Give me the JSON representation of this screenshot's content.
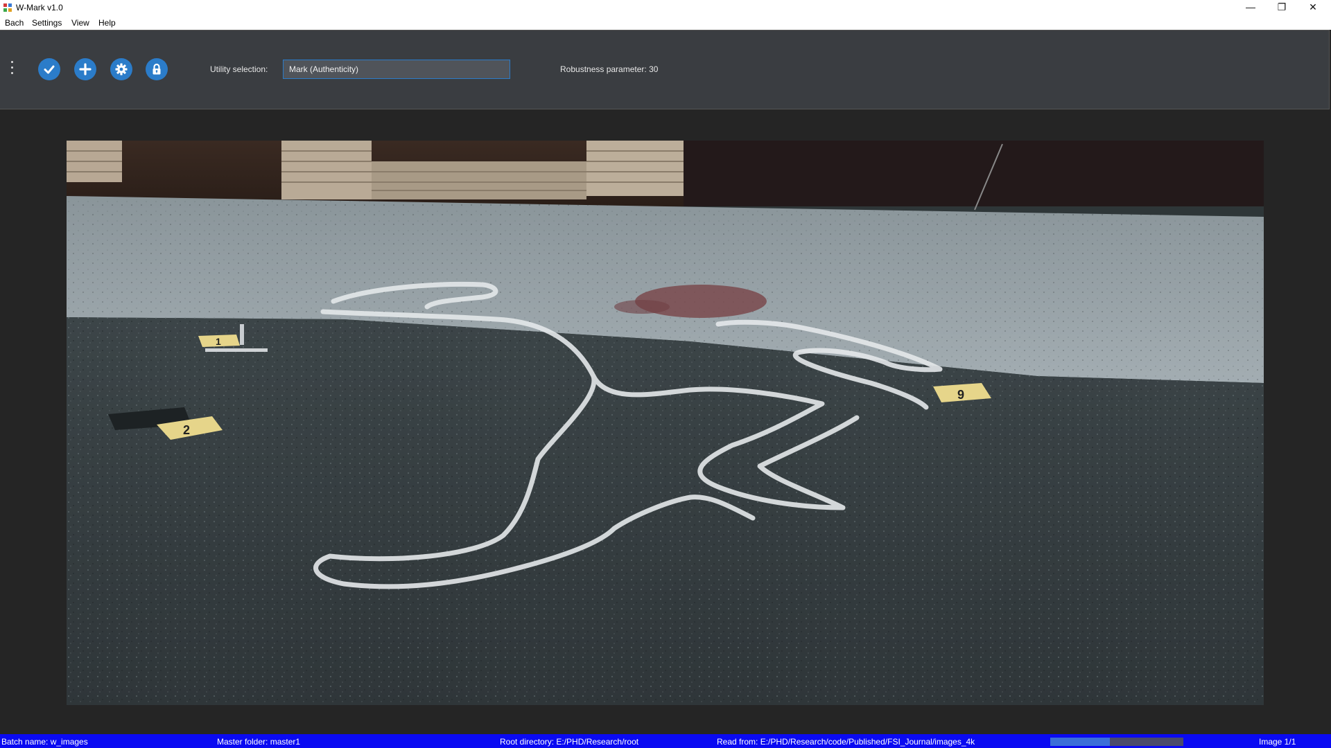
{
  "window": {
    "title": "W-Mark v1.0"
  },
  "menu": {
    "items": [
      "Bach",
      "Settings",
      "View",
      "Help"
    ]
  },
  "toolbar": {
    "icons": [
      "check-icon",
      "plus-icon",
      "gear-icon",
      "lock-icon"
    ],
    "utility_label": "Utility selection:",
    "utility_value": "Mark (Authenticity)",
    "robustness": "Robustness parameter: 30"
  },
  "viewer": {
    "markers": [
      "1",
      "2",
      "9"
    ]
  },
  "status": {
    "batch": "Batch name:  w_images",
    "master": "Master folder:  master1",
    "root": "Root directory:  E:/PHD/Research/root",
    "read": "Read from:  E:/PHD/Research/code/Published/FSI_Journal/images_4k",
    "progress": 0.45,
    "image": "Image  1/1"
  },
  "colors": {
    "accent": "#2b7cc9",
    "statusbar": "#0a0af2",
    "toolbar": "#3a3d41"
  }
}
